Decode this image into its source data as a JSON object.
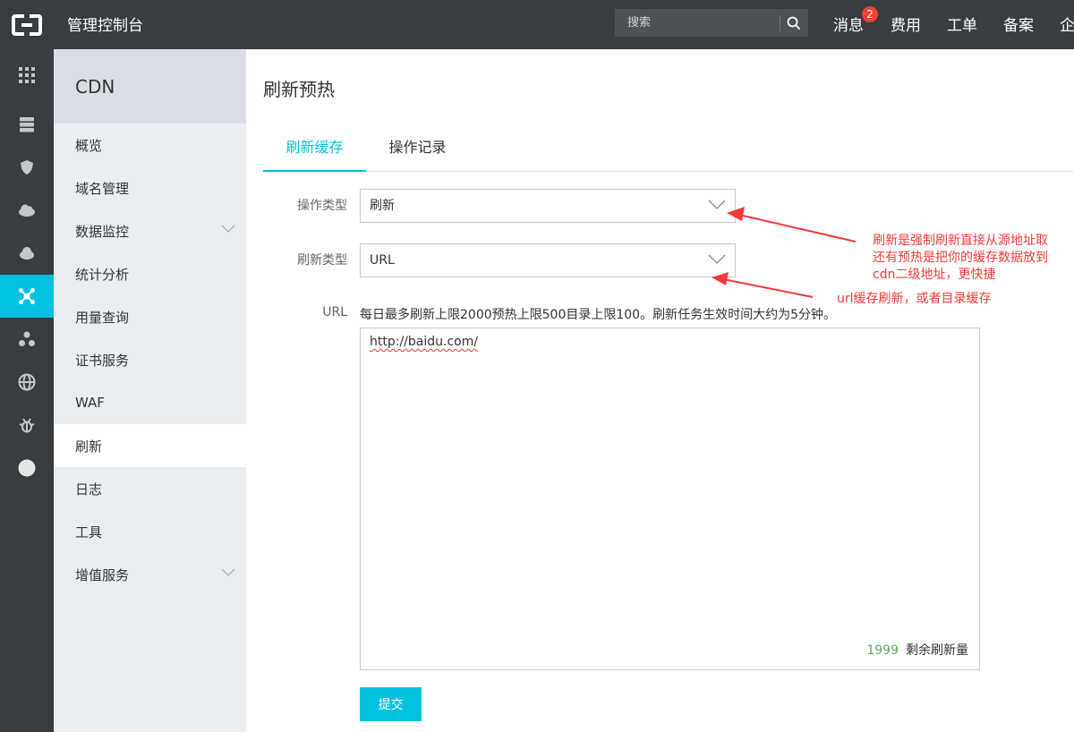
{
  "topbar": {
    "title": "管理控制台",
    "search_placeholder": "搜索",
    "nav": [
      "消息",
      "费用",
      "工单",
      "备案",
      "企"
    ],
    "message_badge": "2"
  },
  "rail": {
    "icons": [
      "grid-icon",
      "server-icon",
      "shield-icon",
      "cloud-icon",
      "cloud-arrow-icon",
      "cdn-icon",
      "nodes-icon",
      "globe-icon",
      "bug-icon",
      "circle-icon"
    ],
    "active_index": 5,
    "accent": "#00c1de"
  },
  "sidebar": {
    "header": "CDN",
    "items": [
      {
        "label": "概览"
      },
      {
        "label": "域名管理"
      },
      {
        "label": "数据监控"
      },
      {
        "label": "统计分析"
      },
      {
        "label": "用量查询"
      },
      {
        "label": "证书服务"
      },
      {
        "label": "WAF"
      },
      {
        "label": "刷新"
      },
      {
        "label": "日志"
      },
      {
        "label": "工具"
      },
      {
        "label": "增值服务"
      }
    ],
    "active_index": 7
  },
  "main": {
    "title": "刷新预热",
    "tabs": [
      {
        "label": "刷新缓存",
        "active": true
      },
      {
        "label": "操作记录",
        "active": false
      }
    ],
    "form": {
      "op_type_label": "操作类型",
      "op_type_value": "刷新",
      "refresh_type_label": "刷新类型",
      "refresh_type_value": "URL",
      "url_label": "URL",
      "url_hint": "每日最多刷新上限2000预热上限500目录上限100。刷新任务生效时间大约为5分钟。",
      "url_value": "http://baidu.com/",
      "remaining_count": "1999",
      "remaining_label": "剩余刷新量",
      "submit_label": "提交"
    }
  },
  "annotations": {
    "op_type_note": [
      "刷新是强制刷新直接从源地址取",
      "还有预热是把你的缓存数据放到",
      "cdn二级地址，更快捷"
    ],
    "refresh_type_note": "url缓存刷新，或者目录缓存",
    "color": "#f23a3a"
  }
}
